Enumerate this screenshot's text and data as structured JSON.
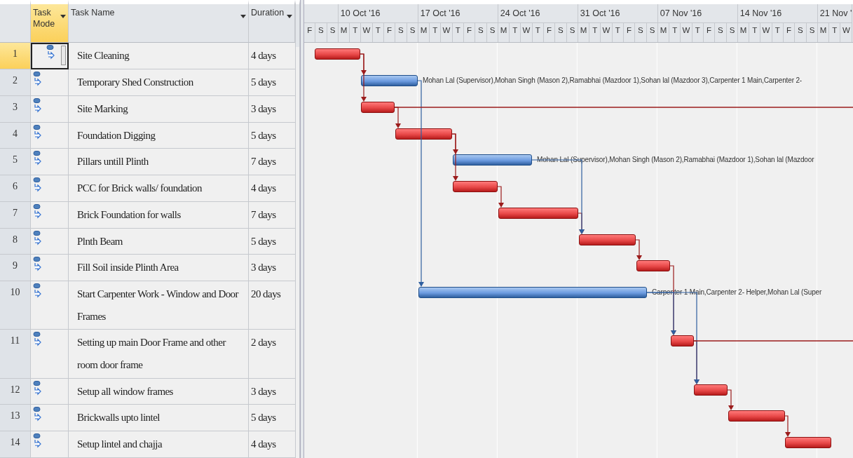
{
  "columns": [
    {
      "label": "Task Mode",
      "selected": true
    },
    {
      "label": "Task Name",
      "selected": false
    },
    {
      "label": "Duration",
      "selected": false
    }
  ],
  "timescale": {
    "weeks": [
      {
        "days": [
          "F",
          "S",
          "S"
        ]
      },
      {
        "label": "10 Oct '16",
        "days": [
          "M",
          "T",
          "W",
          "T",
          "F",
          "S",
          "S"
        ]
      },
      {
        "label": "17 Oct '16",
        "days": [
          "M",
          "T",
          "W",
          "T",
          "F",
          "S",
          "S"
        ]
      },
      {
        "label": "24 Oct '16",
        "days": [
          "M",
          "T",
          "W",
          "T",
          "F",
          "S",
          "S"
        ]
      },
      {
        "label": "31 Oct '16",
        "days": [
          "M",
          "T",
          "W",
          "T",
          "F",
          "S",
          "S"
        ]
      },
      {
        "label": "07 Nov '16",
        "days": [
          "M",
          "T",
          "W",
          "T",
          "F",
          "S",
          "S"
        ]
      },
      {
        "label": "14 Nov '16",
        "days": [
          "M",
          "T",
          "W",
          "T",
          "F",
          "S",
          "S"
        ]
      },
      {
        "label": "21 Nov '",
        "days": [
          "M",
          "T",
          "W"
        ]
      }
    ]
  },
  "tasks": [
    {
      "id": "1",
      "name": "Site Cleaning",
      "duration": "4 days",
      "selected": true,
      "critical": true
    },
    {
      "id": "2",
      "name": "Temporary Shed Construction",
      "duration": "5 days",
      "selected": false,
      "critical": false,
      "resources": "Mohan Lal (Supervisor),Mohan Singh (Mason 2),Ramabhai (Mazdoor 1),Sohan lal (Mazdoor 3),Carpenter 1 Main,Carpenter 2-"
    },
    {
      "id": "3",
      "name": "Site Marking",
      "duration": "3 days",
      "selected": false,
      "critical": true
    },
    {
      "id": "4",
      "name": "Foundation Digging",
      "duration": "5 days",
      "selected": false,
      "critical": true
    },
    {
      "id": "5",
      "name": "Pillars untill Plinth",
      "duration": "7 days",
      "selected": false,
      "critical": false,
      "resources": "Mohan Lal (Supervisor),Mohan Singh (Mason 2),Ramabhai (Mazdoor 1),Sohan lal (Mazdoor"
    },
    {
      "id": "6",
      "name": "PCC for Brick walls/ foundation",
      "duration": "4 days",
      "selected": false,
      "critical": true
    },
    {
      "id": "7",
      "name": "Brick Foundation for walls",
      "duration": "7 days",
      "selected": false,
      "critical": true
    },
    {
      "id": "8",
      "name": "Plnth Beam",
      "duration": "5 days",
      "selected": false,
      "critical": true
    },
    {
      "id": "9",
      "name": "Fill Soil inside Plinth Area",
      "duration": "3 days",
      "selected": false,
      "critical": true
    },
    {
      "id": "10",
      "name": "Start Carpenter Work - Window and Door Frames",
      "duration": "20 days",
      "selected": false,
      "critical": false,
      "resources": "Carpenter 1 Main,Carpenter 2- Helper,Mohan Lal (Super"
    },
    {
      "id": "11",
      "name": "Setting up main Door Frame and other room door frame",
      "duration": "2 days",
      "selected": false,
      "critical": true
    },
    {
      "id": "12",
      "name": "Setup all window frames",
      "duration": "3 days",
      "selected": false,
      "critical": true
    },
    {
      "id": "13",
      "name": "Brickwalls upto lintel",
      "duration": "5 days",
      "selected": false,
      "critical": true
    },
    {
      "id": "14",
      "name": "Setup lintel and chajja",
      "duration": "4 days",
      "selected": false,
      "critical": true
    }
  ]
}
